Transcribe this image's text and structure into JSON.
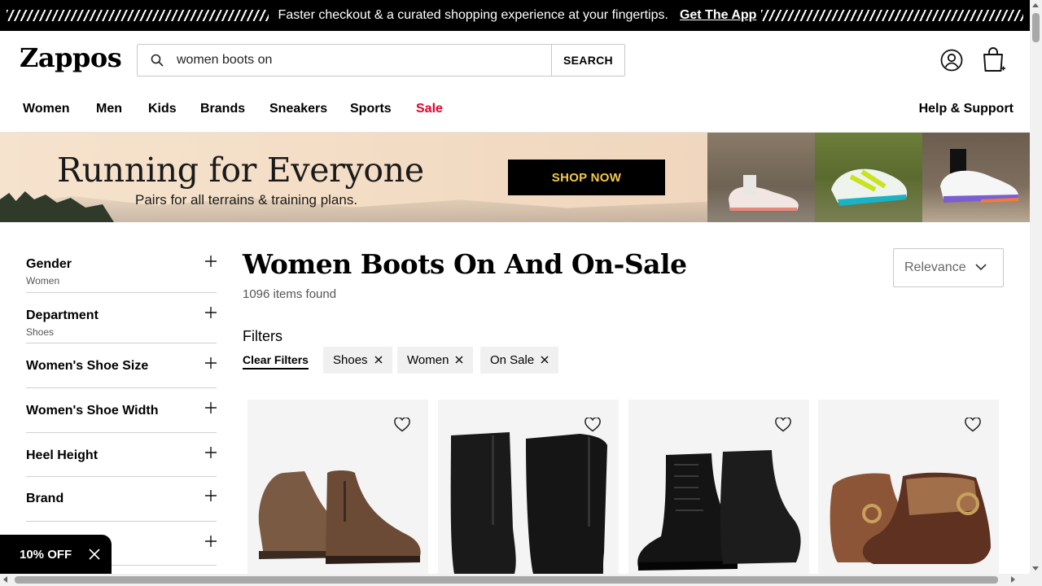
{
  "promo_bar": {
    "message": "Faster checkout & a curated shopping experience at your fingertips.",
    "app_link": "Get The App"
  },
  "header": {
    "logo": "Zappos",
    "search": {
      "value": "women boots on",
      "button": "SEARCH",
      "icon": "search-icon"
    },
    "account_icon": "account-icon",
    "cart_icon": "cart-icon"
  },
  "nav": {
    "items": [
      "Women",
      "Men",
      "Kids",
      "Brands",
      "Sneakers",
      "Sports",
      "Sale"
    ],
    "help": "Help & Support",
    "sale_color": "#e4002b"
  },
  "banner": {
    "headline": "Running for Everyone",
    "subtext": "Pairs for all terrains & training plans.",
    "cta": "SHOP NOW",
    "cta_text_color": "#f2c94c"
  },
  "sidebar": {
    "facets": [
      {
        "title": "Gender",
        "selected": "Women"
      },
      {
        "title": "Department",
        "selected": "Shoes"
      },
      {
        "title": "Women's Shoe Size",
        "selected": ""
      },
      {
        "title": "Women's Shoe Width",
        "selected": ""
      },
      {
        "title": "Heel Height",
        "selected": ""
      },
      {
        "title": "Brand",
        "selected": ""
      },
      {
        "title": "",
        "selected": ""
      }
    ]
  },
  "results": {
    "title": "Women Boots On And On-Sale",
    "count": "1096 items found",
    "sort": "Relevance",
    "filters_label": "Filters",
    "clear_filters": "Clear Filters",
    "chips": [
      "Shoes",
      "Women",
      "On Sale"
    ]
  },
  "products": [
    {
      "image": "brown-ankle-bootie",
      "favorite_icon": "heart-icon"
    },
    {
      "image": "black-mid-calf-boot",
      "favorite_icon": "heart-icon"
    },
    {
      "image": "black-lace-up-boot",
      "favorite_icon": "heart-icon"
    },
    {
      "image": "patterned-brown-bootie",
      "favorite_icon": "heart-icon"
    }
  ],
  "discount_tab": {
    "label": "10% OFF"
  }
}
